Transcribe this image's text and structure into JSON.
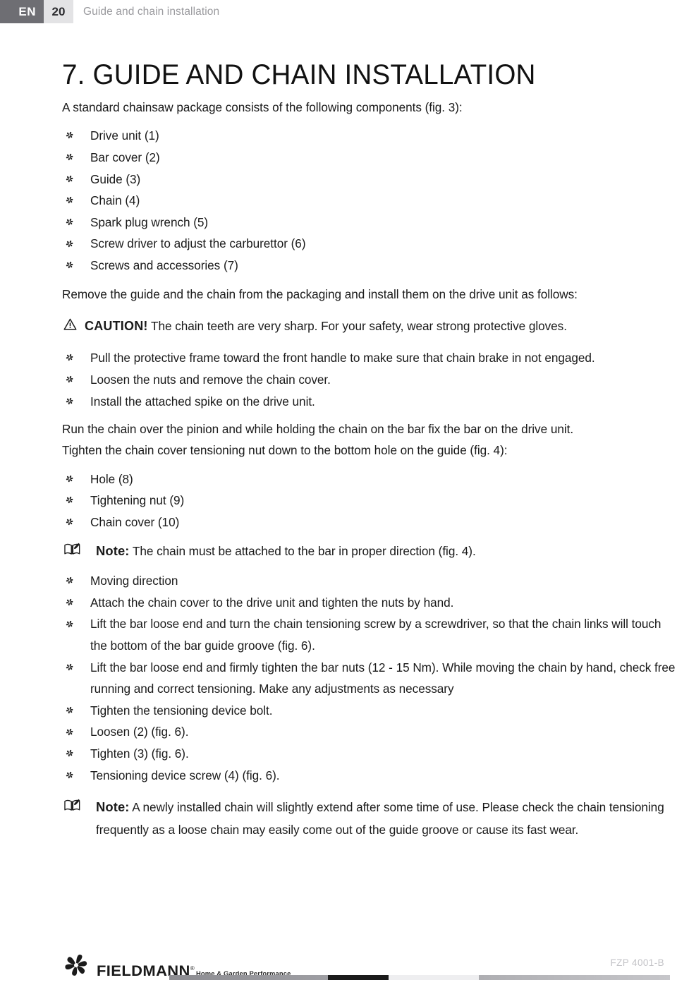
{
  "header": {
    "language": "EN",
    "page_number": "20",
    "section_title": "Guide and chain installation"
  },
  "document": {
    "title": "7. GUIDE AND CHAIN INSTALLATION",
    "intro": "A standard chainsaw package consists of the following components (fig. 3):",
    "components": [
      "Drive unit (1)",
      "Bar cover (2)",
      "Guide (3)",
      "Chain (4)",
      "Spark plug wrench (5)",
      "Screw driver to adjust the carburettor (6)",
      "Screws and accessories (7)"
    ],
    "remove_paragraph": "Remove the guide and the chain from the packaging and install them on the drive unit as follows:",
    "caution": {
      "label": "CAUTION!",
      "text": "The chain teeth are very sharp. For your safety, wear strong protective gloves.",
      "icon": "warning-triangle-icon"
    },
    "steps_first": [
      "Pull the protective frame toward the front handle to make sure that chain brake in not engaged.",
      "Loosen the nuts and remove the chain cover.",
      "Install the attached spike on the drive unit."
    ],
    "run_paragraph": "Run the chain over the pinion and while holding the chain on the bar fix the bar on the drive unit.",
    "tighten_paragraph": "Tighten the chain cover tensioning nut down to the bottom hole on the guide (fig. 4):",
    "parts": [
      "Hole (8)",
      "Tightening nut (9)",
      "Chain cover (10)"
    ],
    "note_one": {
      "label": "Note:",
      "text": "The chain must be attached to the bar in proper direction (fig. 4).",
      "icon": "open-book-icon"
    },
    "steps_second": [
      "Moving direction",
      "Attach the chain cover to the drive unit and tighten the nuts by hand.",
      "Lift the bar loose end and turn the chain tensioning screw by a screwdriver, so that the chain links will touch the bottom of the bar guide groove (fig. 6).",
      "Lift the bar loose end and firmly tighten the bar nuts (12 - 15 Nm). While moving the chain by hand, check free running and correct tensioning. Make any adjustments as necessary",
      "Tighten the tensioning device bolt.",
      "Loosen (2) (fig. 6).",
      "Tighten (3) (fig. 6).",
      "Tensioning device screw (4) (fig. 6)."
    ],
    "note_two": {
      "label": "Note:",
      "text": "A newly installed chain will slightly extend after some time of use. Please check the chain tensioning frequently as a loose chain may easily come out of the guide groove or cause its fast wear.",
      "icon": "open-book-icon"
    },
    "bullet_icon": "pinwheel-flower-bullet-icon"
  },
  "footer": {
    "brand": "FIELDMANN",
    "brand_registered": "®",
    "tagline": "Home & Garden Performance",
    "model_code": "FZP 4001-B",
    "logo_icon": "fieldmann-pinwheel-logo-icon"
  },
  "colors": {
    "header_lang_bg": "#6e6e73",
    "header_page_bg": "#e3e3e5",
    "header_title_text": "#9a9a9e",
    "body_text": "#1a1a1a",
    "footer_code_text": "#c3c3c7",
    "bar_dark": "#1b1b1b",
    "bar_light": "#eeeef0",
    "bar_mid": "#9e9ea3"
  }
}
